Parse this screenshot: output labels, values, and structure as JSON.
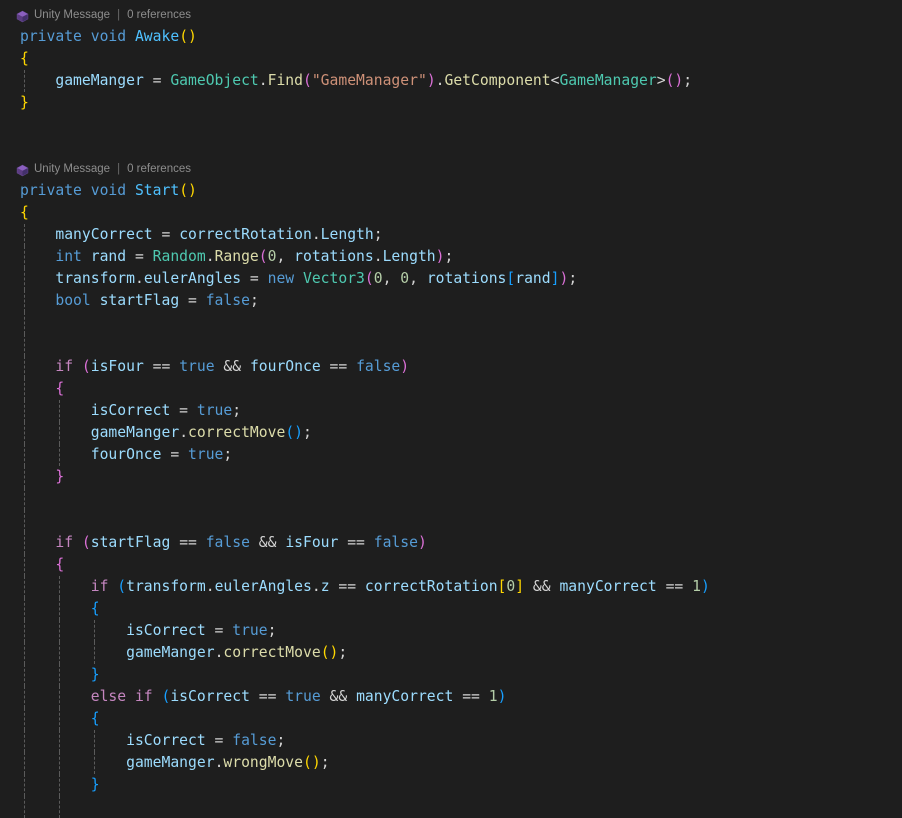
{
  "editor": {
    "language": "csharp",
    "theme": "dark-plus",
    "background_color": "#1e1e1e",
    "font_size_px": 14.7,
    "line_height_px": 22,
    "colors": {
      "keyword": "#569cd6",
      "control": "#c586c0",
      "type": "#4ec9b0",
      "method": "#dcdcaa",
      "method_declaration": "#4fc1ff",
      "variable": "#9cdcfe",
      "string": "#ce9178",
      "number": "#b5cea8",
      "punctuation": "#d4d4d4",
      "codelens": "#8d8d8d",
      "indent_guide": "#707070",
      "bracket_level_1": "#ffd700",
      "bracket_level_2": "#da70d6",
      "bracket_level_3": "#179fff"
    }
  },
  "codelens": [
    {
      "icon": "unity-cube-icon",
      "label": "Unity Message",
      "separator": "|",
      "references": "0 references"
    },
    {
      "icon": "unity-cube-icon",
      "label": "Unity Message",
      "separator": "|",
      "references": "0 references"
    }
  ],
  "code": {
    "awake_method": {
      "signature": {
        "modifier": "private",
        "return_type": "void",
        "name": "Awake",
        "parens": "()"
      },
      "open_brace": "{",
      "close_brace": "}",
      "body": {
        "target": "gameManger",
        "equals": " = ",
        "type": "GameObject",
        "dot1": ".",
        "find": "Find",
        "open_paren": "(",
        "string_arg": "\"GameManager\"",
        "close_paren": ")",
        "dot2": ".",
        "get_component": "GetComponent",
        "generic_open": "<",
        "generic_type": "GameManager",
        "generic_close": ">",
        "call": "()",
        "semicolon": ";"
      }
    },
    "start_method": {
      "signature": {
        "modifier": "private",
        "return_type": "void",
        "name": "Start",
        "parens": "()"
      },
      "open_brace": "{",
      "statements": {
        "many_correct": {
          "lhs": "manyCorrect",
          "rhs_obj": "correctRotation",
          "rhs_prop": "Length"
        },
        "rand": {
          "type": "int",
          "name": "rand",
          "class": "Random",
          "method": "Range",
          "arg0": "0",
          "arg1_obj": "rotations",
          "arg1_prop": "Length"
        },
        "euler": {
          "obj": "transform",
          "prop": "eulerAngles",
          "new_kw": "new",
          "type": "Vector3",
          "x": "0",
          "y": "0",
          "z_arr": "rotations",
          "z_idx": "rand"
        },
        "start_flag": {
          "type": "bool",
          "name": "startFlag",
          "value": "false"
        }
      },
      "if_four": {
        "keyword": "if",
        "cond_a_var": "isFour",
        "cond_a_op": "==",
        "cond_a_val": "true",
        "logic_op": "&&",
        "cond_b_var": "fourOnce",
        "cond_b_op": "==",
        "cond_b_val": "false",
        "body": {
          "set_correct": {
            "lhs": "isCorrect",
            "value": "true"
          },
          "call_correct": {
            "obj": "gameManger",
            "method": "correctMove"
          },
          "set_four_once": {
            "lhs": "fourOnce",
            "value": "true"
          }
        }
      },
      "if_start_flag": {
        "keyword": "if",
        "cond_a_var": "startFlag",
        "cond_a_op": "==",
        "cond_a_val": "false",
        "logic_op": "&&",
        "cond_b_var": "isFour",
        "cond_b_op": "==",
        "cond_b_val": "false",
        "inner_if": {
          "keyword": "if",
          "obj": "transform",
          "prop": "eulerAngles",
          "axis": "z",
          "op1": "==",
          "arr": "correctRotation",
          "idx": "0",
          "logic_op": "&&",
          "cond_b_var": "manyCorrect",
          "cond_b_op": "==",
          "cond_b_val": "1",
          "body": {
            "set_correct": {
              "lhs": "isCorrect",
              "value": "true"
            },
            "call_correct": {
              "obj": "gameManger",
              "method": "correctMove"
            }
          }
        },
        "else_if": {
          "keyword": "else if",
          "cond_a_var": "isCorrect",
          "cond_a_op": "==",
          "cond_a_val": "true",
          "logic_op": "&&",
          "cond_b_var": "manyCorrect",
          "cond_b_op": "==",
          "cond_b_val": "1",
          "body": {
            "set_correct": {
              "lhs": "isCorrect",
              "value": "false"
            },
            "call_wrong": {
              "obj": "gameManger",
              "method": "wrongMove"
            }
          }
        }
      }
    }
  }
}
